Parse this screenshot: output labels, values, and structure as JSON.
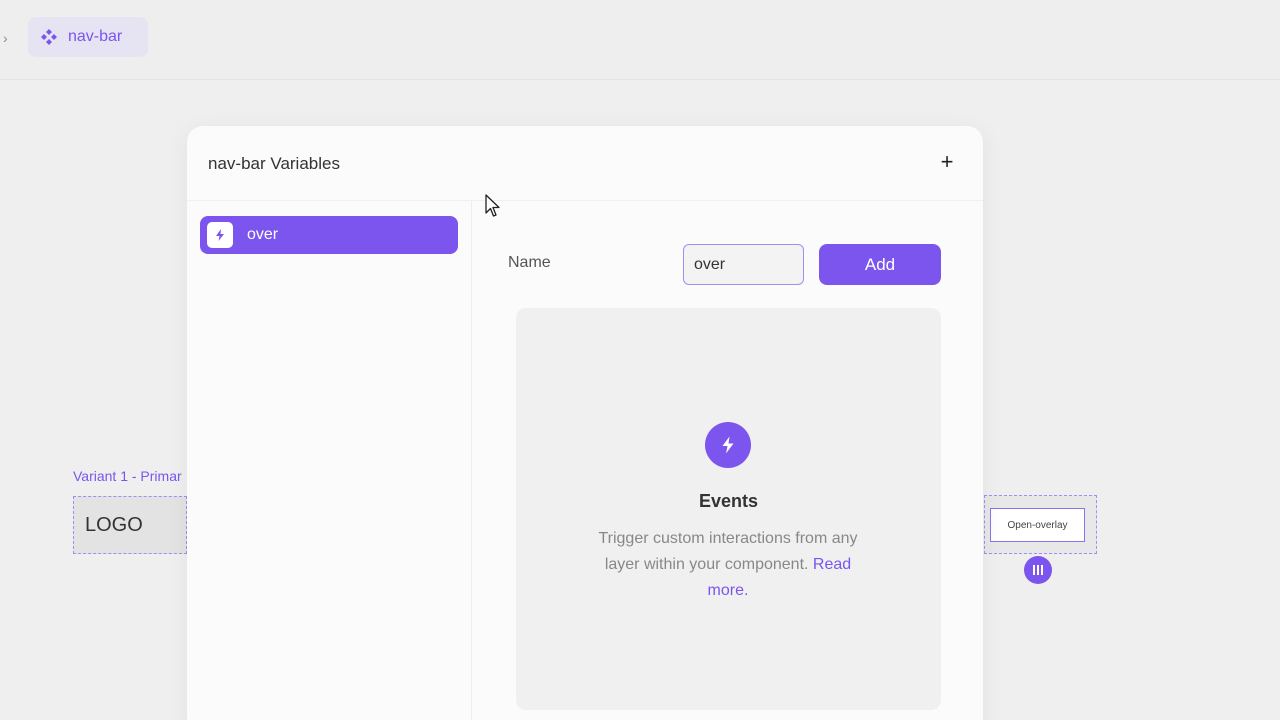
{
  "breadcrumb": {
    "chevron": "›",
    "component_name": "nav-bar"
  },
  "canvas": {
    "variant_label": "Variant 1 - Primar",
    "logo_text": "LOGO",
    "overlay_button": "Open-overlay"
  },
  "modal": {
    "title": "nav-bar Variables",
    "add_symbol": "+",
    "variables": [
      {
        "label": "over"
      }
    ],
    "form": {
      "name_label": "Name",
      "name_value": "over",
      "add_label": "Add"
    },
    "events": {
      "title": "Events",
      "description": "Trigger custom interactions from any layer within your component.",
      "link": "Read more."
    }
  },
  "colors": {
    "accent": "#7b55ee",
    "background": "#efefef",
    "modal": "#fbfbfb"
  }
}
